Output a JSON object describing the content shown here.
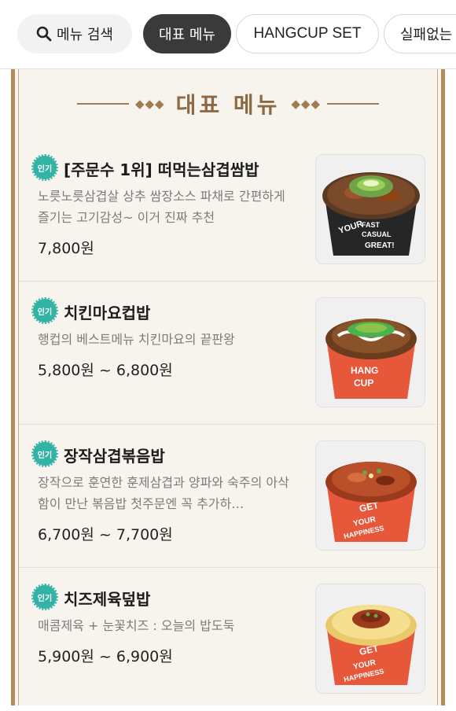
{
  "tabs": {
    "search_label": "메뉴 검색",
    "items": [
      "대표 메뉴",
      "HANGCUP SET",
      "실패없는"
    ]
  },
  "section": {
    "title": "대표 메뉴"
  },
  "badge_label": "인기",
  "items": [
    {
      "name": "[주문수 1위] 떠먹는삼겹쌈밥",
      "desc": "노릇노릇삼겹살 상추 쌈장소스 파채로 간편하게 즐기는 고기감성~ 이거 진짜 추천",
      "price": "7,800원",
      "cup_color": "#262626",
      "cup_text": "YOUR FAST CASUAL GREAT!",
      "topping": "green-onion-pork"
    },
    {
      "name": "치킨마요컵밥",
      "desc": "행컵의 베스트메뉴 치킨마요의 끝판왕",
      "price": "5,800원 ~ 6,800원",
      "cup_color": "#e7573a",
      "cup_text": "HANG CUP",
      "topping": "chicken-mayo"
    },
    {
      "name": "장작삼겹볶음밥",
      "desc": "장작으로 훈연한 훈제삼겹과 양파와 숙주의 아삭함이 만난 볶음밥 첫주문엔 꼭 추가하…",
      "price": "6,700원 ~ 7,700원",
      "cup_color": "#e7573a",
      "cup_text": "GET YOUR HAPPINESS",
      "topping": "fried-rice"
    },
    {
      "name": "치즈제육덮밥",
      "desc": "매콤제육 + 눈꽃치즈 : 오늘의 밥도둑",
      "price": "5,900원 ~ 6,900원",
      "cup_color": "#e7573a",
      "cup_text": "GET YOUR HAPPINESS",
      "topping": "cheese-pork"
    }
  ],
  "colors": {
    "accent": "#32b3a6",
    "frame": "#b48c58",
    "title": "#8d6a44",
    "active_tab": "#3a3a3a"
  }
}
